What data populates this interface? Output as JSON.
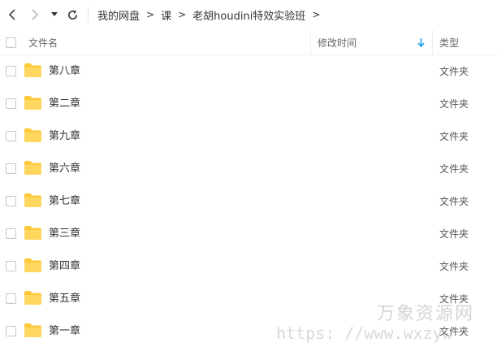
{
  "toolbar": {
    "back_icon": "chevron-left-icon",
    "forward_icon": "chevron-right-icon",
    "history_icon": "caret-down-icon",
    "refresh_icon": "refresh-icon"
  },
  "breadcrumb": {
    "items": [
      "我的网盘",
      "课",
      "老胡houdini特效实验班"
    ],
    "separator": ">"
  },
  "columns": {
    "name": "文件名",
    "modified": "修改时间",
    "type": "类型",
    "sort_icon": "arrow-down-icon",
    "sort_color": "#1a9ff0"
  },
  "files": [
    {
      "name": "第八章",
      "type": "文件夹"
    },
    {
      "name": "第二章",
      "type": "文件夹"
    },
    {
      "name": "第九章",
      "type": "文件夹"
    },
    {
      "name": "第六章",
      "type": "文件夹"
    },
    {
      "name": "第七章",
      "type": "文件夹"
    },
    {
      "name": "第三章",
      "type": "文件夹"
    },
    {
      "name": "第四章",
      "type": "文件夹"
    },
    {
      "name": "第五章",
      "type": "文件夹"
    },
    {
      "name": "第一章",
      "type": "文件夹"
    }
  ],
  "folder_color": "#ffd04b",
  "watermark": {
    "line1": "万象资源网",
    "line2": "https: //www.wxzyw"
  }
}
